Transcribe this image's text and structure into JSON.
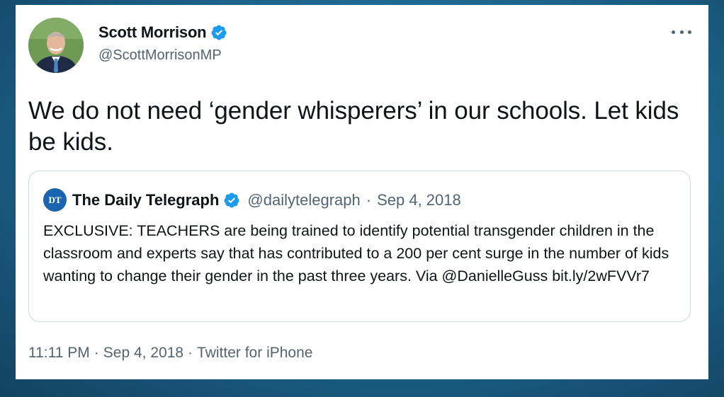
{
  "tweet": {
    "author_name": "Scott Morrison",
    "author_handle": "@ScottMorrisonMP",
    "text": "We do not need ‘gender whisperers’ in our schools. Let kids be kids.",
    "time": "11:11 PM",
    "date": "Sep 4, 2018",
    "client": "Twitter for iPhone",
    "separator": "·"
  },
  "quoted_tweet": {
    "logo_text": "DT",
    "author_name": "The Daily Telegraph",
    "author_handle": "@dailytelegraph",
    "separator": "·",
    "date": "Sep 4, 2018",
    "text": "EXCLUSIVE: TEACHERS are being trained to identify potential transgender children in the classroom and experts say that has contributed to a 200 per cent surge in the number of kids wanting to change their gender in the past three years. Via @DanielleGuss bit.ly/2wFVVr7"
  },
  "colors": {
    "verified_badge": "#1d9bf0",
    "primary_text": "#0f1419",
    "secondary_text": "#536471",
    "border": "#cfd9de",
    "background_gradient": "#1f6a93"
  },
  "icons": {
    "verified": "verified-badge-icon",
    "more": "more-options-icon"
  }
}
